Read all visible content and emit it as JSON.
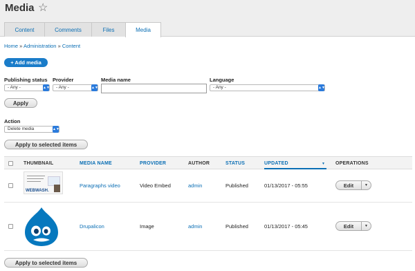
{
  "page": {
    "title": "Media",
    "star_icon": "star-outline-icon"
  },
  "tabs": [
    {
      "label": "Content"
    },
    {
      "label": "Comments"
    },
    {
      "label": "Files"
    },
    {
      "label": "Media",
      "active": true
    }
  ],
  "breadcrumb": {
    "home": "Home",
    "sep": "»",
    "admin": "Administration",
    "content": "Content"
  },
  "add_media_label": "+ Add media",
  "filters": {
    "publishing_status": {
      "label": "Publishing status",
      "value": "- Any -"
    },
    "provider": {
      "label": "Provider",
      "value": "- Any -"
    },
    "media_name": {
      "label": "Media name",
      "value": ""
    },
    "language": {
      "label": "Language",
      "value": "- Any -"
    },
    "apply_label": "Apply"
  },
  "bulk": {
    "action_label": "Action",
    "action_value": "Delete media",
    "apply_selected_label": "Apply to selected items"
  },
  "table": {
    "headers": {
      "thumbnail": "THUMBNAIL",
      "media_name": "MEDIA NAME",
      "provider": "PROVIDER",
      "author": "AUTHOR",
      "status": "STATUS",
      "updated": "UPDATED",
      "operations": "OPERATIONS"
    },
    "rows": [
      {
        "name": "Paragraphs video",
        "provider": "Video Embed",
        "author": "admin",
        "status": "Published",
        "updated": "01/13/2017 - 05:55",
        "edit": "Edit",
        "thumb_text": "WEBWASH."
      },
      {
        "name": "Drupalicon",
        "provider": "Image",
        "author": "admin",
        "status": "Published",
        "updated": "01/13/2017 - 05:45",
        "edit": "Edit"
      }
    ]
  },
  "colors": {
    "link": "#0a6eb4",
    "primary_button": "#1a7cc9",
    "drupal_blue": "#0678be"
  }
}
